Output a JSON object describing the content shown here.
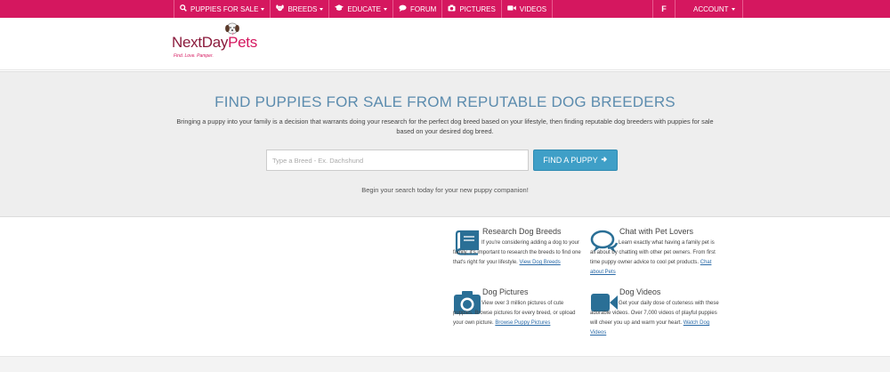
{
  "nav": {
    "items": [
      {
        "label": "Puppies for Sale",
        "icon": "search-icon",
        "has_caret": true
      },
      {
        "label": "Breeds",
        "icon": "dog-face-icon",
        "has_caret": true
      },
      {
        "label": "Educate",
        "icon": "graduation-cap-icon",
        "has_caret": true
      },
      {
        "label": "Forum",
        "icon": "chat-icon",
        "has_caret": false
      },
      {
        "label": "Pictures",
        "icon": "camera-icon",
        "has_caret": false
      },
      {
        "label": "Videos",
        "icon": "video-camera-icon",
        "has_caret": false
      }
    ],
    "facebook_label": "f",
    "account_label": "Account"
  },
  "logo": {
    "name_part1": "NextDay",
    "name_part2": "Pets",
    "tagline": "Find. Love. Pamper.",
    "icon": "dog-logo-icon"
  },
  "hero": {
    "title": "Find Puppies for Sale from Reputable Dog Breeders",
    "description": "Bringing a puppy into your family is a decision that warrants doing your research for the perfect dog breed based on your lifestyle, then finding reputable dog breeders with puppies for sale based on your desired dog breed.",
    "search_placeholder": "Type a Breed - Ex. Dachshund",
    "button_label": "Find a Puppy",
    "tagline": "Begin your search today for your new puppy companion!"
  },
  "features": [
    {
      "title": "Research Dog Breeds",
      "icon": "book-icon",
      "body": "If you're considering adding a dog to your family, it's important to research the breeds to find one that's right for your lifestyle. ",
      "link": "View Dog Breeds"
    },
    {
      "title": "Chat with Pet Lovers",
      "icon": "chat-bubbles-icon",
      "body": "Learn exactly what having a family pet is all about by chatting with other pet owners. From first time puppy owner advice to cool pet products. ",
      "link": "Chat about Pets"
    },
    {
      "title": "Dog Pictures",
      "icon": "camera-icon",
      "body": "View over 3 million pictures of cute puppies. Browse pictures for every breed, or upload your own picture. ",
      "link": "Browse Puppy Pictures"
    },
    {
      "title": "Dog Videos",
      "icon": "video-camera-icon",
      "body": "Get your daily dose of cuteness with these adorable videos. Over 7,000 videos of playful puppies will cheer you up and warm your heart. ",
      "link": "Watch Dog Videos"
    }
  ],
  "colors": {
    "brand": "#d5175f",
    "accent": "#3f9fc7",
    "title_blue": "#5c8cae",
    "icon_blue": "#2a6f96"
  }
}
